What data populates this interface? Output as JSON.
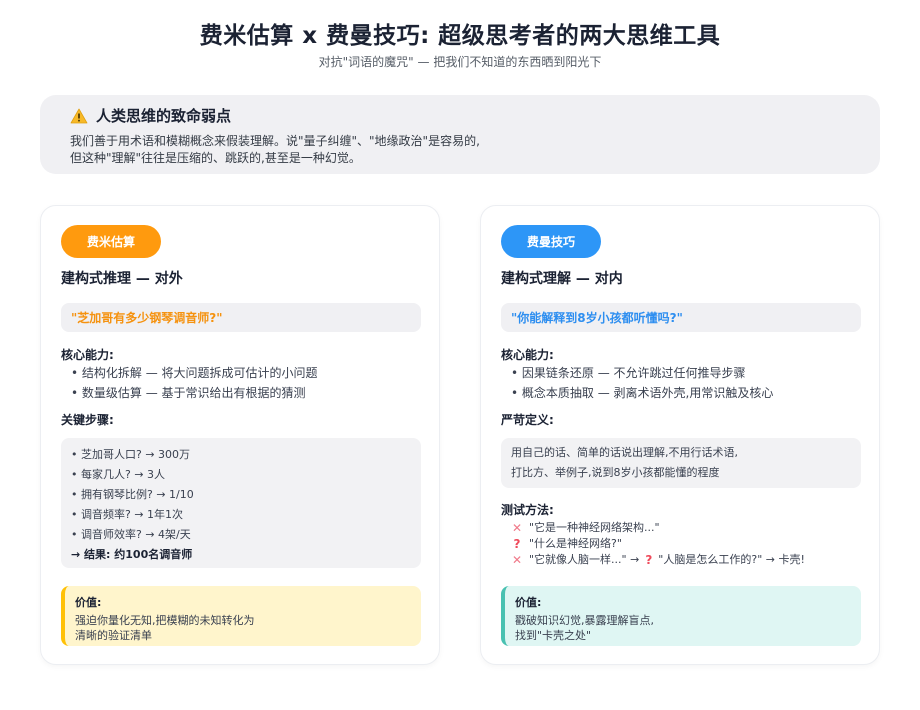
{
  "header": {
    "title": "费米估算 x 费曼技巧: 超级思考者的两大思维工具",
    "subtitle": "对抗\"词语的魔咒\" — 把我们不知道的东西晒到阳光下"
  },
  "warning": {
    "icon": "warning-icon",
    "title": "人类思维的致命弱点",
    "line1": "我们善于用术语和模糊概念来假装理解。说\"量子纠缠\"、\"地缘政治\"是容易的,",
    "line2": "但这种\"理解\"往往是压缩的、跳跃的,甚至是一种幻觉。"
  },
  "fermi": {
    "tag": "费米估算",
    "accent": "#ff9a0e",
    "heading": "建构式推理 — 对外",
    "quote": "\"芝加哥有多少钢琴调音师?\"",
    "core_label": "核心能力:",
    "core_items": [
      "结构化拆解 — 将大问题拆成可估计的小问题",
      "数量级估算 — 基于常识给出有根据的猜测"
    ],
    "steps_label": "关键步骤:",
    "steps": [
      "芝加哥人口? → 300万",
      "每家几人? → 3人",
      "拥有钢琴比例? → 1/10",
      "调音频率? → 1年1次",
      "调音师效率? → 4架/天"
    ],
    "result": "→ 结果: 约100名调音师",
    "value_title": "价值:",
    "value_line1": "强迫你量化无知,把模糊的未知转化为",
    "value_line2": "清晰的验证清单"
  },
  "feynman": {
    "tag": "费曼技巧",
    "accent": "#2d96f7",
    "heading": "建构式理解 — 对内",
    "quote": "\"你能解释到8岁小孩都听懂吗?\"",
    "core_label": "核心能力:",
    "core_items": [
      "因果链条还原 — 不允许跳过任何推导步骤",
      "概念本质抽取 — 剥离术语外壳,用常识触及核心"
    ],
    "def_label": "严苛定义:",
    "def_line1": "用自己的话、简单的话说出理解,不用行话术语,",
    "def_line2": "打比方、举例子,说到8岁小孩都能懂的程度",
    "test_label": "测试方法:",
    "test1": "\"它是一种神经网络架构...\"",
    "test2": "\"什么是神经网络?\"",
    "test3a": "\"它就像人脑一样...\" →",
    "test3b": "\"人脑是怎么工作的?\" → 卡壳!",
    "value_title": "价值:",
    "value_line1": "戳破知识幻觉,暴露理解盲点,",
    "value_line2": "找到\"卡壳之处\""
  }
}
